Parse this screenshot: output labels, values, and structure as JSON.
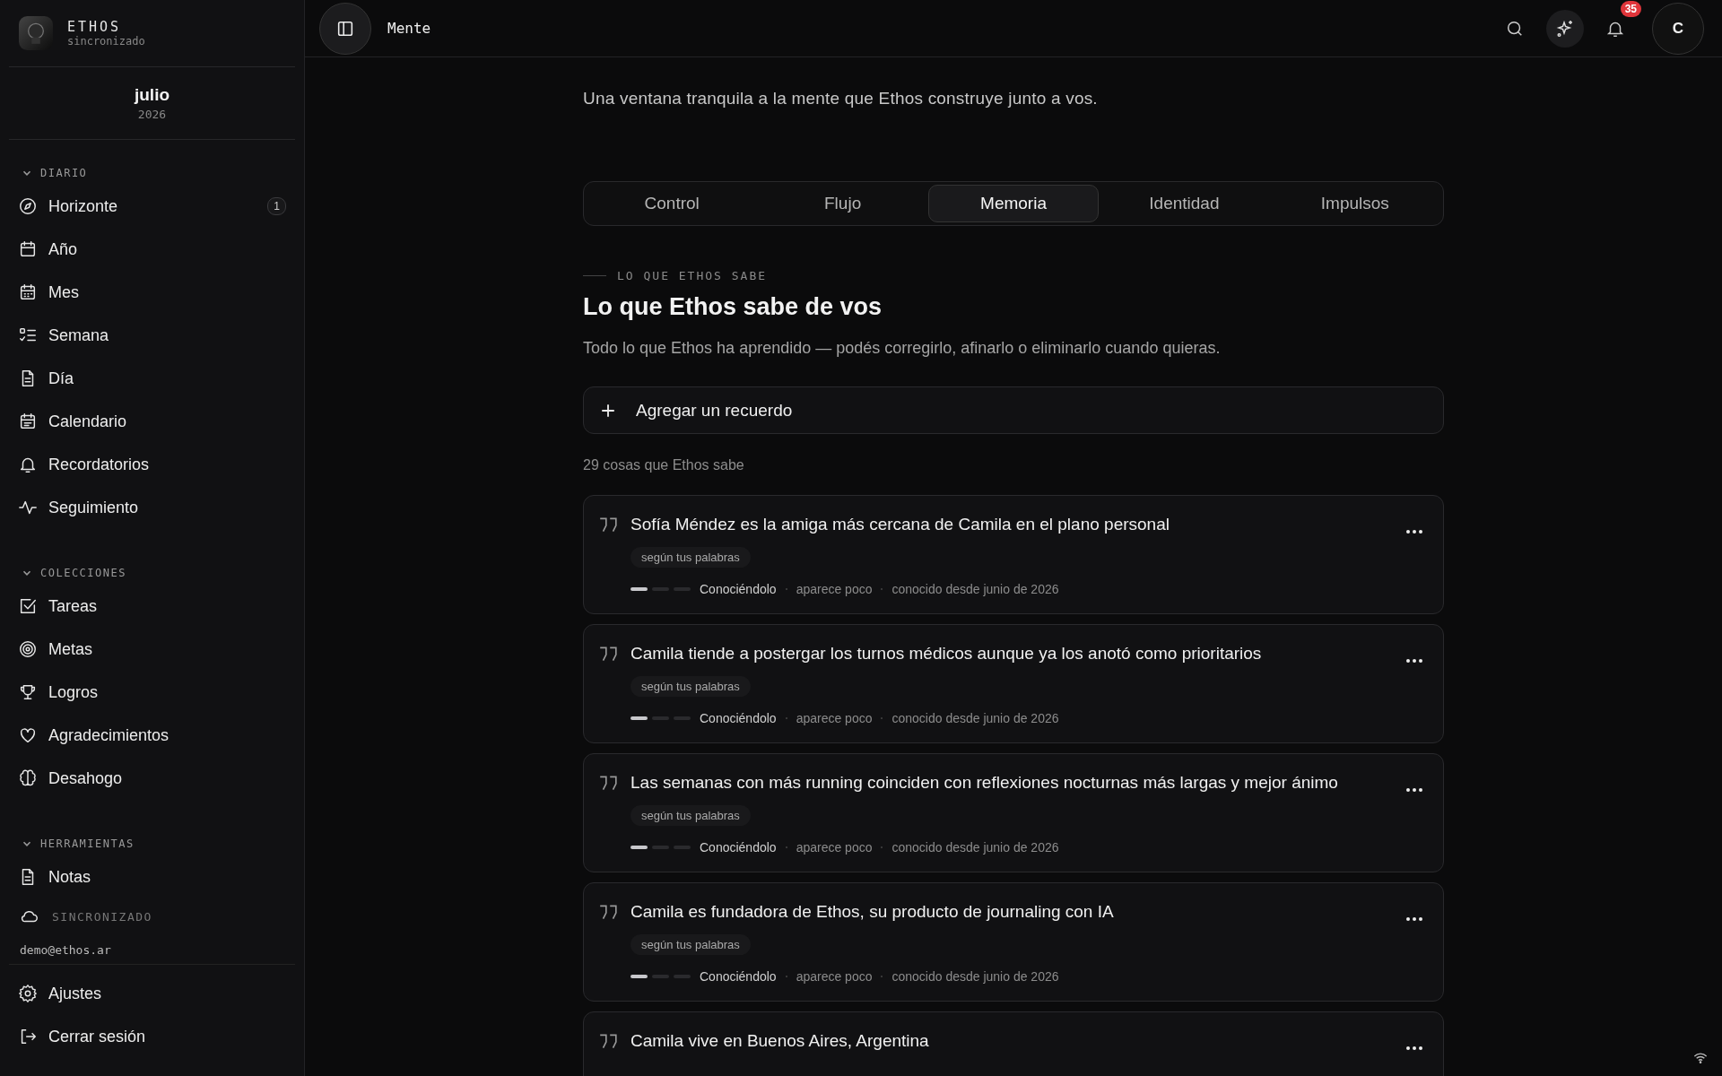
{
  "brand": {
    "name": "ETHOS",
    "status": "sincronizado"
  },
  "period": {
    "month": "julio",
    "year": "2026"
  },
  "sidebar": {
    "sections": [
      {
        "title": "DIARIO",
        "expanded": true,
        "items": [
          {
            "label": "Horizonte",
            "badge": "1"
          },
          {
            "label": "Año"
          },
          {
            "label": "Mes"
          },
          {
            "label": "Semana"
          },
          {
            "label": "Día"
          },
          {
            "label": "Calendario"
          },
          {
            "label": "Recordatorios"
          },
          {
            "label": "Seguimiento"
          }
        ]
      },
      {
        "title": "COLECCIONES",
        "expanded": true,
        "items": [
          {
            "label": "Tareas"
          },
          {
            "label": "Metas"
          },
          {
            "label": "Logros"
          },
          {
            "label": "Agradecimientos"
          },
          {
            "label": "Desahogo"
          }
        ]
      },
      {
        "title": "HERRAMIENTAS",
        "expanded": true,
        "items": [
          {
            "label": "Notas"
          }
        ]
      }
    ],
    "sync_status": "SINCRONIZADO",
    "email": "demo@ethos.ar",
    "footer": [
      {
        "label": "Ajustes"
      },
      {
        "label": "Cerrar sesión"
      }
    ]
  },
  "topbar": {
    "title": "Mente",
    "notifications": "35",
    "avatar": "C"
  },
  "intro": "Una ventana tranquila a la mente que Ethos construye junto a vos.",
  "tabs": [
    {
      "label": "Control",
      "selected": false
    },
    {
      "label": "Flujo",
      "selected": false
    },
    {
      "label": "Memoria",
      "selected": true
    },
    {
      "label": "Identidad",
      "selected": false
    },
    {
      "label": "Impulsos",
      "selected": false
    }
  ],
  "section": {
    "eyebrow": "LO QUE ETHOS SABE",
    "heading": "Lo que Ethos sabe de vos",
    "description": "Todo lo que Ethos ha aprendido — podés corregirlo, afinarlo o eliminarlo cuando quieras."
  },
  "add_button": "Agregar un recuerdo",
  "count": "29 cosas que Ethos sabe",
  "memories": [
    {
      "text": "Sofía Méndez es la amiga más cercana de Camila en el plano personal",
      "tag": "según tus palabras",
      "level": 0.33,
      "stage": "Conociéndolo",
      "frequency": "aparece poco",
      "since": "conocido desde junio de 2026"
    },
    {
      "text": "Camila tiende a postergar los turnos médicos aunque ya los anotó como prioritarios",
      "tag": "según tus palabras",
      "level": 0.33,
      "stage": "Conociéndolo",
      "frequency": "aparece poco",
      "since": "conocido desde junio de 2026"
    },
    {
      "text": "Las semanas con más running coinciden con reflexiones nocturnas más largas y mejor ánimo",
      "tag": "según tus palabras",
      "level": 0.33,
      "stage": "Conociéndolo",
      "frequency": "aparece poco",
      "since": "conocido desde junio de 2026"
    },
    {
      "text": "Camila es fundadora de Ethos, su producto de journaling con IA",
      "tag": "según tus palabras",
      "level": 0.33,
      "stage": "Conociéndolo",
      "frequency": "aparece poco",
      "since": "conocido desde junio de 2026"
    },
    {
      "text": "Camila vive en Buenos Aires, Argentina"
    }
  ]
}
